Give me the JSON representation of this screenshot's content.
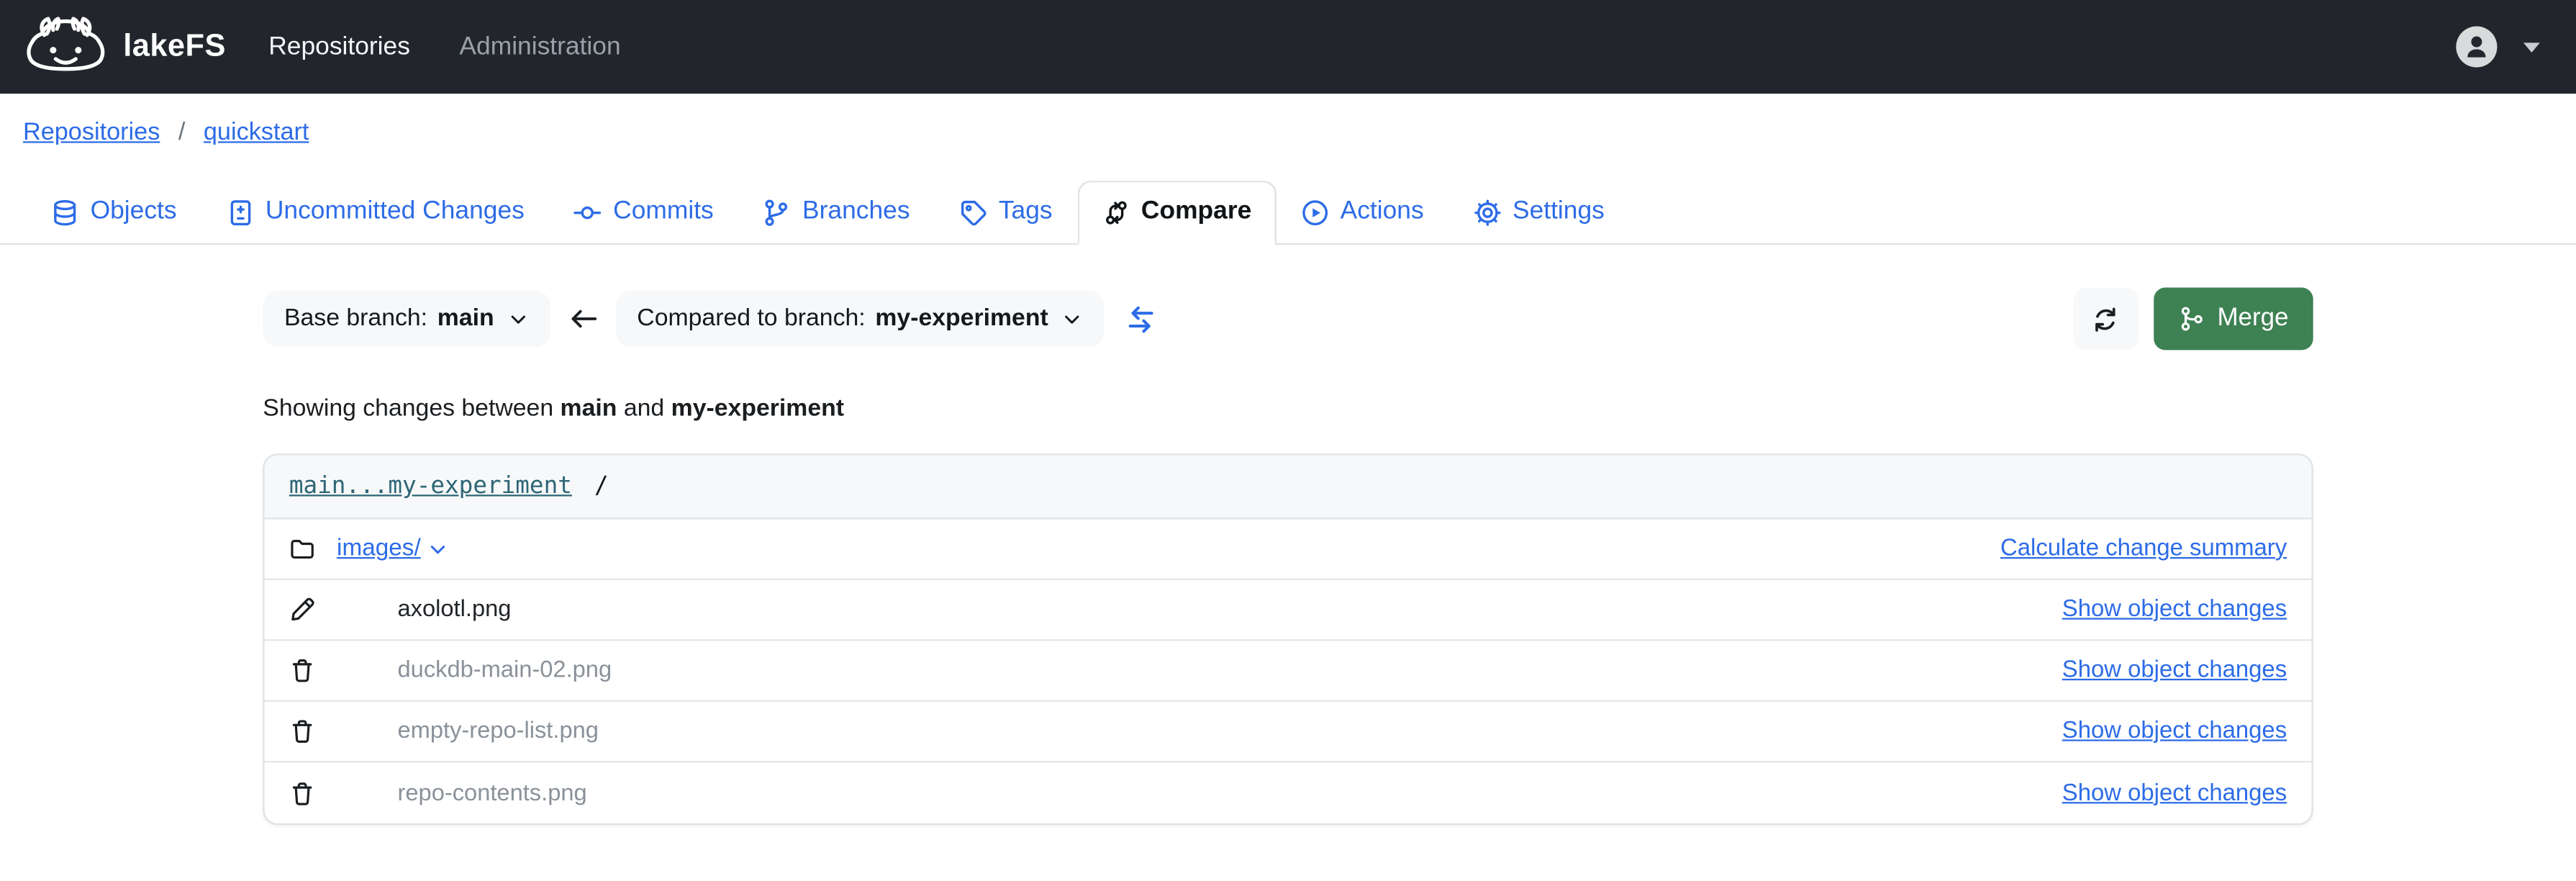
{
  "navbar": {
    "brand": "lakeFS",
    "items": [
      {
        "label": "Repositories",
        "active": true
      },
      {
        "label": "Administration",
        "active": false
      }
    ]
  },
  "breadcrumb": {
    "items": [
      {
        "label": "Repositories"
      },
      {
        "label": "quickstart"
      }
    ],
    "separator": "/"
  },
  "tabs": [
    {
      "label": "Objects",
      "icon": "database-icon",
      "active": false
    },
    {
      "label": "Uncommitted Changes",
      "icon": "file-diff-icon",
      "active": false
    },
    {
      "label": "Commits",
      "icon": "commit-icon",
      "active": false
    },
    {
      "label": "Branches",
      "icon": "branch-icon",
      "active": false
    },
    {
      "label": "Tags",
      "icon": "tag-icon",
      "active": false
    },
    {
      "label": "Compare",
      "icon": "compare-icon",
      "active": true
    },
    {
      "label": "Actions",
      "icon": "play-circle-icon",
      "active": false
    },
    {
      "label": "Settings",
      "icon": "gear-icon",
      "active": false
    }
  ],
  "compare_bar": {
    "base_label": "Base branch:",
    "base_value": "main",
    "compared_label": "Compared to branch:",
    "compared_value": "my-experiment",
    "merge_label": "Merge"
  },
  "summary": {
    "prefix": "Showing changes between",
    "base": "main",
    "conjunction": "and",
    "compared": "my-experiment"
  },
  "diff_card": {
    "ref_link": "main...my-experiment",
    "path_suffix": "/",
    "dir_row": {
      "icon": "folder-icon",
      "name": "images/",
      "action_label": "Calculate change summary"
    },
    "rows": [
      {
        "icon": "pencil-icon",
        "name": "axolotl.png",
        "state": "changed",
        "action_label": "Show object changes"
      },
      {
        "icon": "trash-icon",
        "name": "duckdb-main-02.png",
        "state": "deleted",
        "action_label": "Show object changes"
      },
      {
        "icon": "trash-icon",
        "name": "empty-repo-list.png",
        "state": "deleted",
        "action_label": "Show object changes"
      },
      {
        "icon": "trash-icon",
        "name": "repo-contents.png",
        "state": "deleted",
        "action_label": "Show object changes"
      }
    ]
  },
  "colors": {
    "accent_blue": "#2d6ce7",
    "merge_green": "#3e8153",
    "ref_teal": "#2e6676",
    "navbar_dark": "#22262c"
  }
}
